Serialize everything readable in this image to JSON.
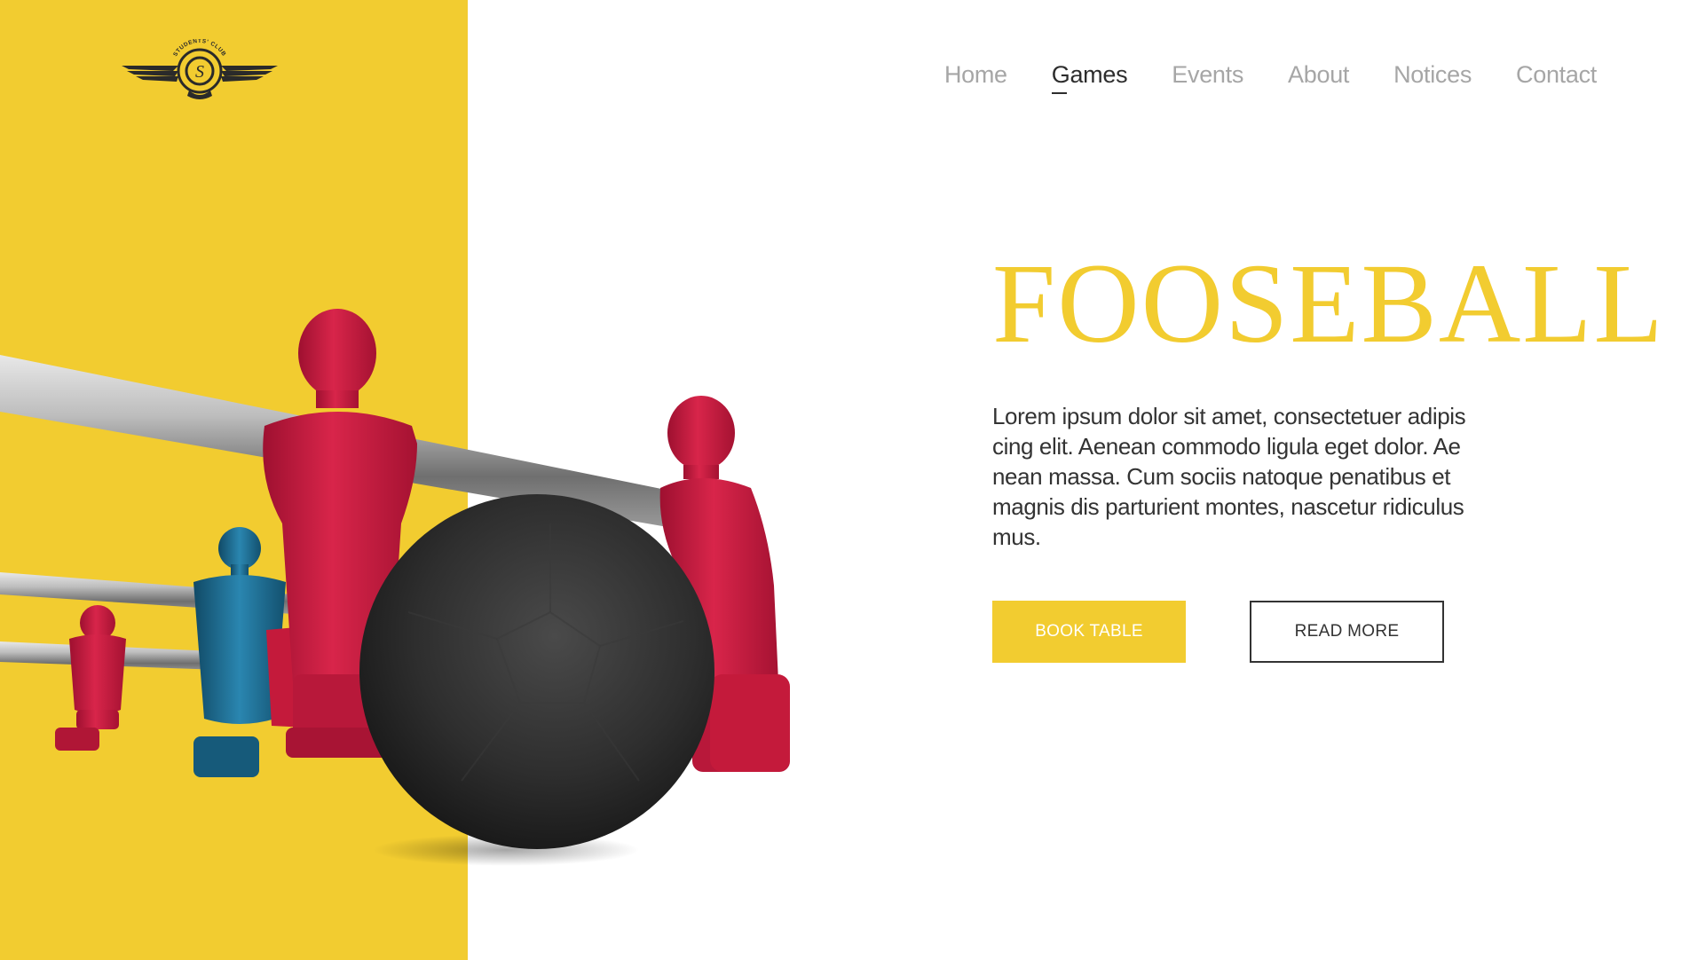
{
  "logo": {
    "text": "STUDENTS' CLUB",
    "icon": "winged-emblem-icon"
  },
  "nav": {
    "items": [
      {
        "label": "Home"
      },
      {
        "label": "Games"
      },
      {
        "label": "Events"
      },
      {
        "label": "About"
      },
      {
        "label": "Notices"
      },
      {
        "label": "Contact"
      }
    ],
    "active": "Games"
  },
  "hero": {
    "title": "FOOSEBALL",
    "description": "Lorem ipsum dolor sit amet, consectetuer adipiscing elit. Aenean commodo ligula eget dolor. Aenean massa. Cum sociis natoque penatibus et magnis dis parturient montes, nascetur ridiculus mus.",
    "buttons": {
      "primary": "BOOK TABLE",
      "secondary": "READ MORE"
    }
  },
  "colors": {
    "accent": "#F2CC30",
    "text_dark": "#333333",
    "nav_inactive": "#A6A6A6",
    "player_red": "#C8193A",
    "player_blue": "#1C6C92",
    "ball": "#2A2A2A"
  }
}
